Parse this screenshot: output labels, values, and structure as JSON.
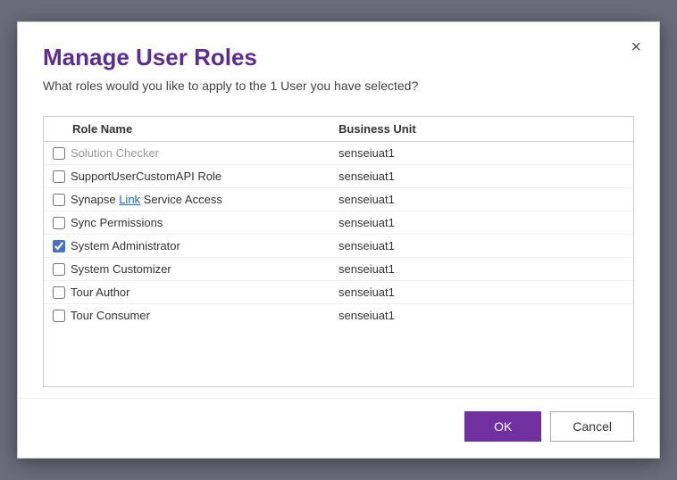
{
  "dialog": {
    "title": "Manage User Roles",
    "subtitle": "What roles would you like to apply to the 1 User you have selected?",
    "close_label": "×"
  },
  "table": {
    "columns": [
      {
        "id": "role_name",
        "label": "Role Name"
      },
      {
        "id": "business_unit",
        "label": "Business Unit"
      }
    ],
    "partial_row": {
      "name": "Solution Checker",
      "bu": "senseiuat1"
    },
    "rows": [
      {
        "id": "row-1",
        "name": "SupportUserCustomAPI Role",
        "bu": "senseiuat1",
        "checked": false,
        "link": null
      },
      {
        "id": "row-2",
        "name": "Synapse Link Service Access",
        "bu": "senseiuat1",
        "checked": false,
        "link": "Link"
      },
      {
        "id": "row-3",
        "name": "Sync Permissions",
        "bu": "senseiuat1",
        "checked": false,
        "link": null
      },
      {
        "id": "row-4",
        "name": "System Administrator",
        "bu": "senseiuat1",
        "checked": true,
        "link": null
      },
      {
        "id": "row-5",
        "name": "System Customizer",
        "bu": "senseiuat1",
        "checked": false,
        "link": null
      },
      {
        "id": "row-6",
        "name": "Tour Author",
        "bu": "senseiuat1",
        "checked": false,
        "link": null
      },
      {
        "id": "row-7",
        "name": "Tour Consumer",
        "bu": "senseiuat1",
        "checked": false,
        "link": null
      }
    ]
  },
  "footer": {
    "ok_label": "OK",
    "cancel_label": "Cancel"
  }
}
